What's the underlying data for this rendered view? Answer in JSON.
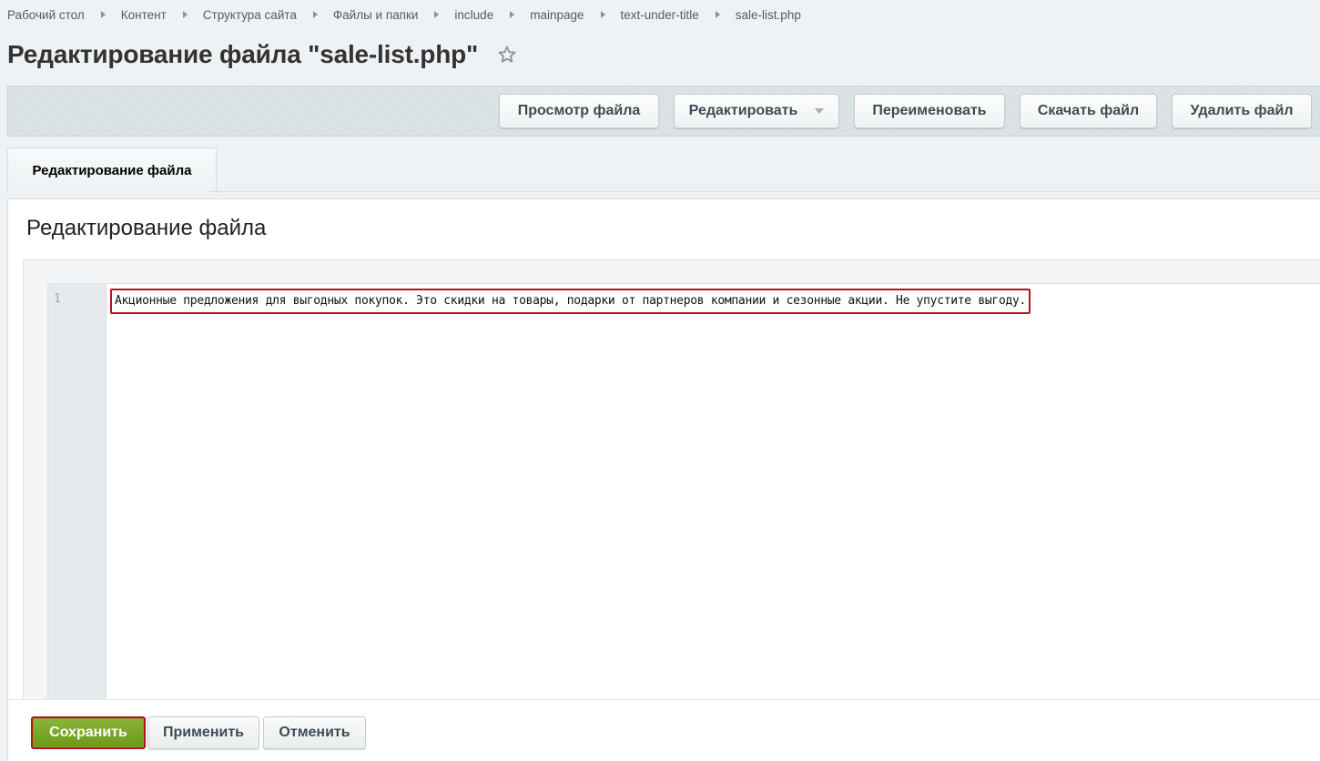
{
  "breadcrumb": {
    "items": [
      "Рабочий стол",
      "Контент",
      "Структура сайта",
      "Файлы и папки",
      "include",
      "mainpage",
      "text-under-title",
      "sale-list.php"
    ]
  },
  "header": {
    "title": "Редактирование файла \"sale-list.php\""
  },
  "toolbar": {
    "view_label": "Просмотр файла",
    "edit_label": "Редактировать",
    "rename_label": "Переименовать",
    "download_label": "Скачать файл",
    "delete_label": "Удалить файл"
  },
  "tabs": [
    {
      "label": "Редактирование файла",
      "active": true
    }
  ],
  "main": {
    "section_title": "Редактирование файла",
    "editor": {
      "lines": [
        {
          "number": "1",
          "text": "Акционные предложения для выгодных покупок. Это скидки на товары, подарки от партнеров компании и сезонные акции. Не упустите выгоду."
        }
      ]
    }
  },
  "footer": {
    "save_label": "Сохранить",
    "apply_label": "Применить",
    "cancel_label": "Отменить"
  },
  "colors": {
    "save_button": "#7aa423",
    "highlight_border": "#b3141e",
    "toolbar_bg": "#d7dfe2",
    "link": "#535c69"
  },
  "icons": {
    "favorite": "star-icon",
    "dropdown": "caret-down-icon",
    "separator": "chevron-right-icon"
  }
}
